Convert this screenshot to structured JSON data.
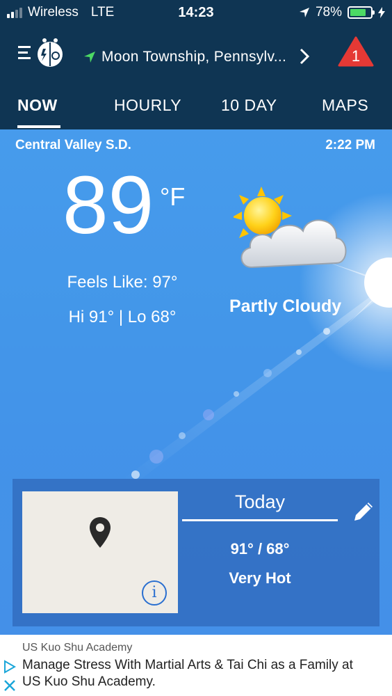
{
  "status_bar": {
    "carrier": "Wireless",
    "network": "LTE",
    "time": "14:23",
    "battery": "78%",
    "battery_fraction": 0.78
  },
  "header": {
    "location": "Moon Township, Pennsylv...",
    "alert_count": "1"
  },
  "tabs": [
    {
      "label": "NOW"
    },
    {
      "label": "HOURLY"
    },
    {
      "label": "10 DAY"
    },
    {
      "label": "MAPS"
    }
  ],
  "current": {
    "station": "Central Valley S.D.",
    "observed_time": "2:22 PM",
    "temperature": "89",
    "unit": "°F",
    "feels_like": "Feels Like: 97°",
    "hi_lo": "Hi 91° | Lo 68°",
    "condition": "Partly Cloudy"
  },
  "today_card": {
    "title": "Today",
    "hi_lo": "91° / 68°",
    "description": "Very Hot"
  },
  "ad": {
    "source": "US Kuo Shu Academy",
    "text": "Manage Stress With Martial Arts & Tai Chi as a Family at US Kuo Shu Academy."
  },
  "colors": {
    "header_bg": "#0f3553",
    "sky": "#3a8fe6",
    "location_arrow": "#4cd964",
    "alert": "#e53935",
    "battery": "#4cd964"
  },
  "icons": [
    "signal-icon",
    "location-arrow-icon",
    "battery-icon",
    "charging-icon",
    "menu-logo-icon",
    "chevron-right-icon",
    "alert-icon",
    "partly-cloudy-icon",
    "map-pin-icon",
    "info-icon",
    "edit-icon",
    "ad-choices-icon",
    "ad-close-icon"
  ]
}
